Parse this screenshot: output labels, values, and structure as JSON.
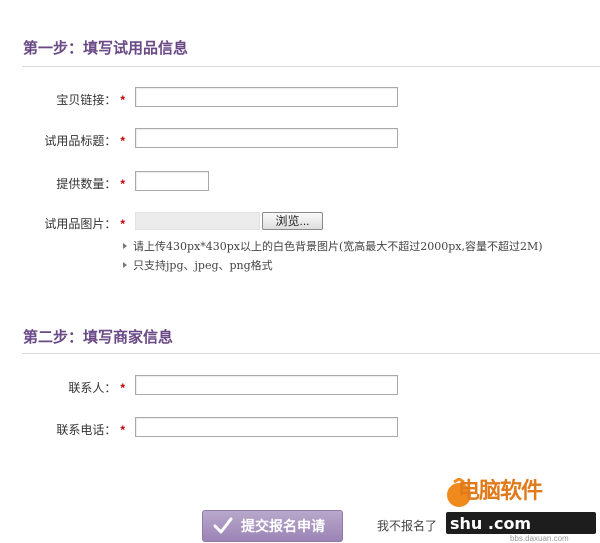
{
  "step1": {
    "title": "第一步：填写试用品信息",
    "fields": {
      "link_label": "宝贝链接：",
      "title_label": "试用品标题：",
      "qty_label": "提供数量：",
      "image_label": "试用品图片："
    },
    "required_mark": "*",
    "browse_label": "浏览...",
    "hints": [
      "请上传430px*430px以上的白色背景图片(宽高最大不超过2000px,容量不超过2M)",
      "只支持jpg、jpeg、png格式"
    ]
  },
  "step2": {
    "title": "第二步：填写商家信息",
    "fields": {
      "contact_label": "联系人：",
      "phone_label": "联系电话："
    },
    "required_mark": "*"
  },
  "actions": {
    "submit_label": "提交报名申请",
    "skip_label": "我不报名了"
  },
  "watermark": {
    "top_text": "电脑软件",
    "bar_text": "shu .com",
    "small_text": "bbs.daxuan.com"
  },
  "colors": {
    "section_title": "#6a4a86",
    "required": "#c40000",
    "submit_bg": "#a592bd"
  },
  "icons": {
    "submit": "check-icon",
    "hint": "triangle-bullet-icon"
  }
}
